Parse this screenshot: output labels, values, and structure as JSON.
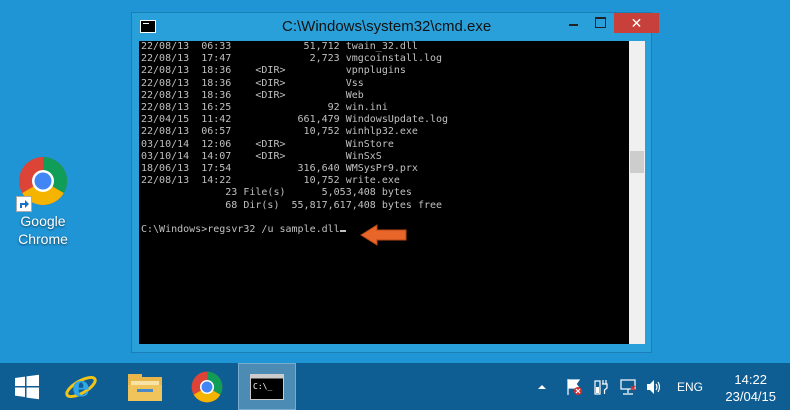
{
  "desktop": {
    "icons": [
      {
        "name": "google-chrome",
        "label_line1": "Google",
        "label_line2": "Chrome"
      }
    ]
  },
  "window": {
    "title": "C:\\Windows\\system32\\cmd.exe",
    "close_glyph": "✕",
    "console_lines": [
      "22/08/13  06:33            51,712 twain_32.dll",
      "22/08/13  17:47             2,723 vmgcoinstall.log",
      "22/08/13  18:36    <DIR>          vpnplugins",
      "22/08/13  18:36    <DIR>          Vss",
      "22/08/13  18:36    <DIR>          Web",
      "22/08/13  16:25                92 win.ini",
      "23/04/15  11:42           661,479 WindowsUpdate.log",
      "22/08/13  06:57            10,752 winhlp32.exe",
      "03/10/14  12:06    <DIR>          WinStore",
      "03/10/14  14:07    <DIR>          WinSxS",
      "18/06/13  17:54           316,640 WMSysPr9.prx",
      "22/08/13  14:22            10,752 write.exe",
      "              23 File(s)      5,053,408 bytes",
      "              68 Dir(s)  55,817,617,408 bytes free",
      ""
    ],
    "prompt": "C:\\Windows>",
    "command": "regsvr32 /u sample.dll"
  },
  "taskbar": {
    "tray_language": "ENG",
    "clock_time": "14:22",
    "clock_date": "23/04/15"
  },
  "colors": {
    "desktop": "#1f95d6",
    "taskbar": "#0e5e93",
    "arrow": "#e8662a"
  }
}
